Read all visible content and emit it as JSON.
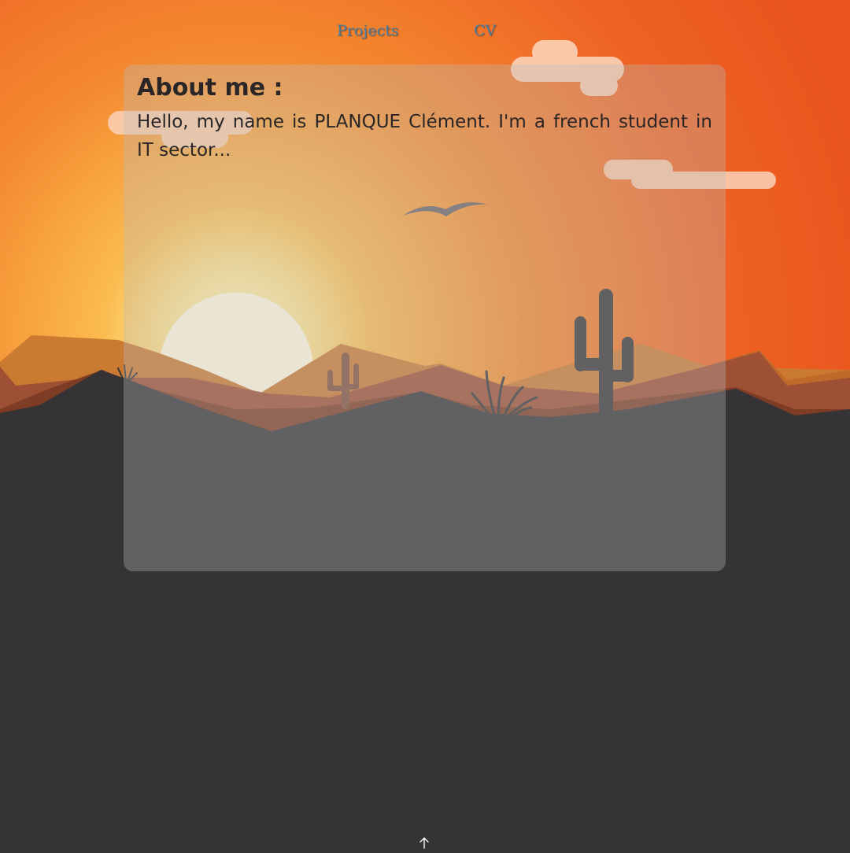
{
  "nav": {
    "projects_label": "Projects",
    "cv_label": "CV"
  },
  "about": {
    "title": "About me :",
    "text": "Hello, my name is PLANQUE Clément. I'm a french student in IT sector..."
  },
  "scroll_top": {
    "icon": "arrow-up-icon"
  },
  "colors": {
    "sky_top": "#ec5a1e",
    "sky_glow": "#f8c45c",
    "sun": "#fff8e0",
    "ground": "#353336",
    "link": "#4d7fa3"
  }
}
